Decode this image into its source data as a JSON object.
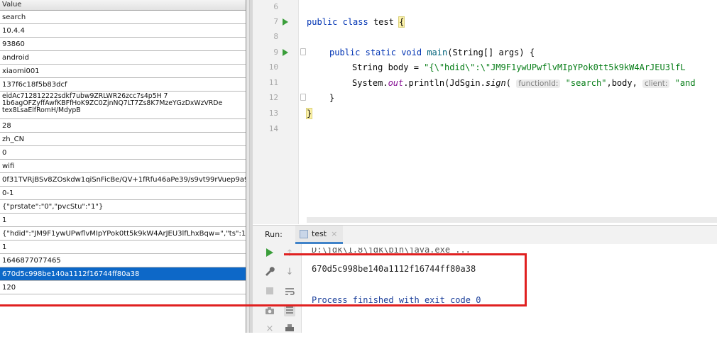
{
  "table": {
    "header": "Value",
    "rows": [
      "search",
      "10.4.4",
      "93860",
      "android",
      "xiaomi001",
      "137f6c18f5b83dcf",
      "eidAc712812222sdkf7ubw9ZRLWR26zcc7s4p5H 7\n1b6agOFZyffAwfKBFfHoK9ZC0ZjnNQ7LT7Zs8K7MzeYGzDxWzVRDe\ntex8LsaElfRomH/MdypB",
      "28",
      "zh_CN",
      "0",
      "wifi",
      "0f31TVRjBSv8ZOskdw1qiSnFicBe/QV+1fRfu46aPe39/s9vt99rVuep9a9V",
      "0-1",
      "{\"prstate\":\"0\",\"pvcStu\":\"1\"}",
      "1",
      "{\"hdid\":\"JM9F1ywUPwflvMIpYPok0tt5k9kW4ArJEU3lfLhxBqw=\",\"ts\":164",
      "1",
      "1646877077465",
      "670d5c998be140a1112f16744ff80a38",
      "120"
    ],
    "selected_index": 18
  },
  "editor": {
    "gutter_numbers": [
      "6",
      "7",
      "8",
      "9",
      "10",
      "11",
      "12",
      "13",
      "14"
    ],
    "code": {
      "line7_kw1": "public",
      "line7_kw2": "class",
      "line7_name": "test",
      "line7_brace": "{",
      "line9_kw1": "public",
      "line9_kw2": "static",
      "line9_kw3": "void",
      "line9_fn": "main",
      "line9_rest": "(String[] args) {",
      "line10_type": "String",
      "line10_var": " body = ",
      "line10_str": "\"{\\\"hdid\\\":\\\"JM9F1ywUPwflvMIpYPok0tt5k9kW4ArJEU3lfL",
      "line11_pre": "System.",
      "line11_static": "out",
      "line11_mid": ".println(JdSgin.",
      "line11_sign": "sign",
      "line11_paren": "(",
      "line11_hint1": "functionId:",
      "line11_str1": "\"search\"",
      "line11_body": ",body, ",
      "line11_hint2": "client:",
      "line11_str2": "\"and",
      "line12_brace": "}",
      "line13_brace": "}"
    }
  },
  "run": {
    "label": "Run:",
    "tab_label": "test",
    "tab_close": "×",
    "console": {
      "cmd": "D:\\jdk\\1.8\\jdk\\bin\\java.exe ...",
      "hash": "670d5c998be140a1112f16744ff80a38",
      "exit": "Process finished with exit code 0"
    }
  },
  "icons": {
    "run": "run-icon",
    "wrench": "wrench-icon",
    "stop": "stop-icon",
    "camera": "camera-icon",
    "close": "close-icon",
    "up": "up-arrow-icon",
    "down": "down-arrow-icon",
    "soft_wrap": "soft-wrap-icon",
    "print": "print-icon"
  },
  "colors": {
    "selection": "#0d68c8",
    "annotation": "#e02020",
    "run_green": "#3a9e3a"
  }
}
